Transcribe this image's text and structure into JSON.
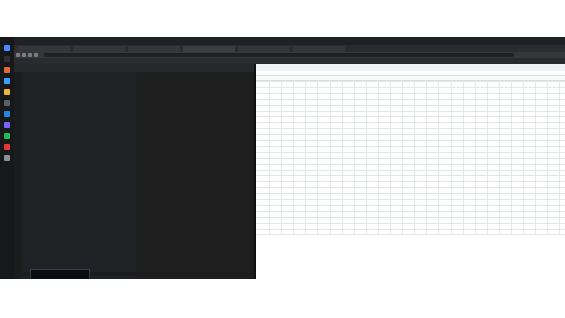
{
  "app": {
    "colors": {
      "chrome_dark": "#202124",
      "chrome_tab": "#35363a",
      "editor_bg": "#1e1e1e",
      "sidebar_bg": "#202124",
      "sheet_bg": "#ffffff",
      "gridline": "#e3e6ea",
      "header_bg": "#f8f9fa",
      "accent_blue": "#1a73e8"
    }
  },
  "browser": {
    "tabs": [
      {
        "label": "",
        "active": false
      },
      {
        "label": "",
        "active": false
      },
      {
        "label": "",
        "active": false
      },
      {
        "label": "",
        "active": true
      },
      {
        "label": "",
        "active": false
      },
      {
        "label": "",
        "active": false
      }
    ],
    "address_icons": [
      "back-icon",
      "forward-icon",
      "reload-icon",
      "site-info-icon"
    ],
    "bookmarks": [
      "",
      "",
      "",
      "",
      "",
      "",
      "",
      "",
      "",
      "",
      "",
      "",
      "",
      "",
      ""
    ]
  },
  "vscode": {
    "explorer_items": [
      "",
      "",
      "",
      "",
      "",
      "",
      "",
      "",
      ""
    ],
    "editor_lines": [
      "",
      "",
      "",
      "",
      "",
      "",
      "",
      "",
      "",
      "",
      "",
      "",
      "",
      "",
      "",
      ""
    ]
  },
  "spreadsheet": {
    "share_label": "",
    "column_headers": [
      "",
      "",
      "",
      "",
      "",
      "",
      "",
      "",
      "",
      "",
      "",
      "",
      "",
      "",
      "",
      "",
      "",
      "",
      "",
      "",
      "",
      "",
      "",
      ""
    ],
    "rows": [],
    "footer_note": ""
  },
  "taskbar": {
    "icons": [
      "windows-icon",
      "search-icon",
      "browser-icon",
      "mail-icon",
      "folder-icon",
      "terminal-icon",
      "code-icon",
      "chat-icon",
      "music-icon",
      "camera-icon",
      "settings-icon"
    ]
  }
}
